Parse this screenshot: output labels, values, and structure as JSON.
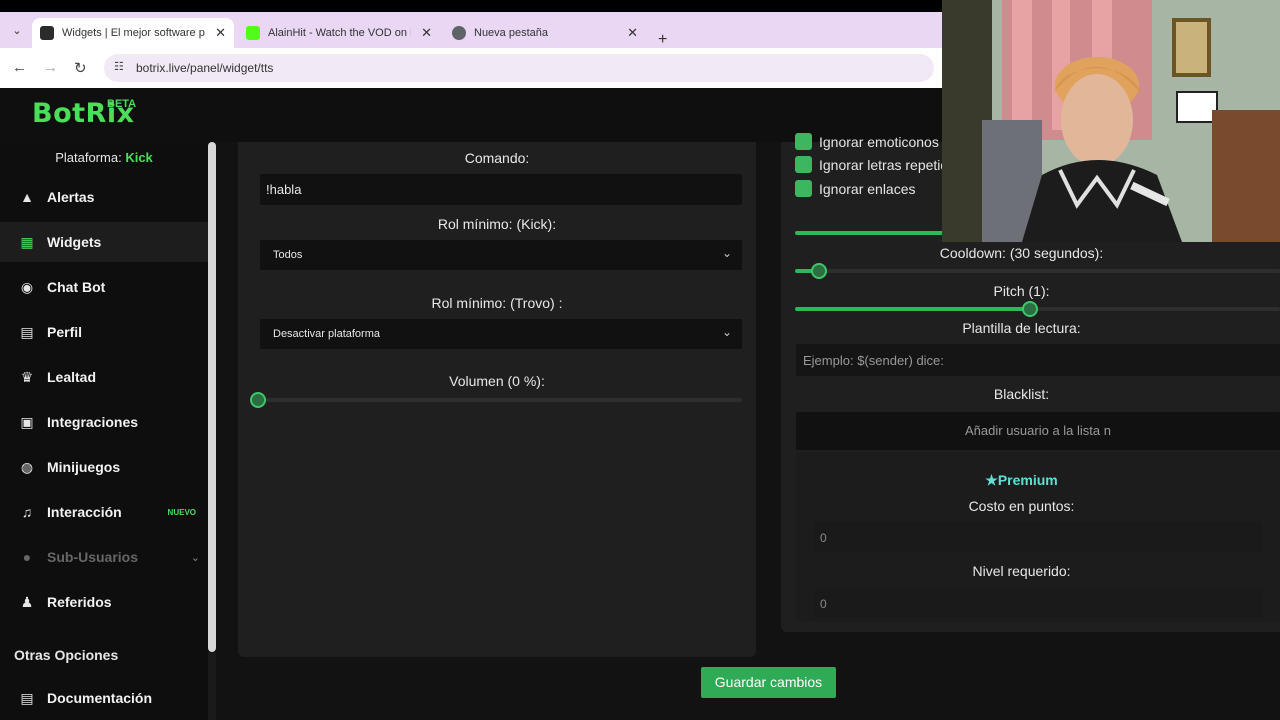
{
  "browser": {
    "tabs": [
      {
        "title": "Widgets | El mejor software para",
        "favicon_color": "#2b2b2b",
        "active": true
      },
      {
        "title": "AlainHit - Watch the VOD on Kick",
        "favicon_color": "#53fc18",
        "active": false
      },
      {
        "title": "Nueva pestaña",
        "favicon_color": "#5f6368",
        "active": false
      }
    ],
    "close_glyph": "✕",
    "new_tab_glyph": "+",
    "tab_list_glyph": "⌄",
    "url": "botrix.live/panel/widget/tts",
    "nav": {
      "back": "←",
      "forward": "→",
      "reload": "↻",
      "site_info": "☷"
    }
  },
  "app": {
    "logo": "BotRix",
    "logo_badge": "BETA",
    "accent_color": "#4ade59"
  },
  "sidebar": {
    "platform_label": "Plataforma:",
    "platform_value": "Kick",
    "items": [
      {
        "label": "Alertas",
        "icon": "warning-icon",
        "glyph": "▲"
      },
      {
        "label": "Widgets",
        "icon": "widgets-icon",
        "glyph": "▦",
        "active": true
      },
      {
        "label": "Chat Bot",
        "icon": "robot-icon",
        "glyph": "◉"
      },
      {
        "label": "Perfil",
        "icon": "profile-card-icon",
        "glyph": "▤"
      },
      {
        "label": "Lealtad",
        "icon": "trophy-icon",
        "glyph": "♛"
      },
      {
        "label": "Integraciones",
        "icon": "integrations-icon",
        "glyph": "▣"
      },
      {
        "label": "Minijuegos",
        "icon": "gamepad-icon",
        "glyph": "◍"
      },
      {
        "label": "Interacción",
        "icon": "music-icon",
        "glyph": "♫",
        "badge": "NUEVO"
      },
      {
        "label": "Sub-Usuarios",
        "icon": "sub-users-icon",
        "glyph": "●",
        "disabled": true
      },
      {
        "label": "Referidos",
        "icon": "users-icon",
        "glyph": "♟"
      }
    ],
    "section_title": "Otras Opciones",
    "doc_item": {
      "label": "Documentación",
      "icon": "document-icon",
      "glyph": "▤"
    }
  },
  "form_left": {
    "command_label": "Comando:",
    "command_value": "!habla",
    "role_kick_label": "Rol mínimo: (Kick):",
    "role_kick_value": "Todos",
    "role_trovo_label": "Rol mínimo: (Trovo) :",
    "role_trovo_value": "Desactivar plataforma",
    "volume_label": "Volumen (0 %):",
    "volume_value": 0
  },
  "form_right": {
    "checkboxes": [
      {
        "label": "Ignorar emoticonos",
        "checked": true
      },
      {
        "label": "Ignorar letras repetidas",
        "checked": true
      },
      {
        "label": "Ignorar enlaces",
        "checked": true
      }
    ],
    "cooldown_label": "Cooldown: (30 segundos):",
    "cooldown_fraction": 0.05,
    "pitch_label": "Pitch (1):",
    "pitch_fraction": 0.5,
    "template_label": "Plantilla de lectura:",
    "template_placeholder": "Ejemplo: $(sender) dice:",
    "blacklist_label": "Blacklist:",
    "blacklist_placeholder": "Añadir usuario a la lista n",
    "premium_label": "Premium",
    "cost_label": "Costo en puntos:",
    "cost_value": "0",
    "level_label": "Nivel requerido:",
    "level_value": "0"
  },
  "actions": {
    "save_label": "Guardar cambios"
  }
}
